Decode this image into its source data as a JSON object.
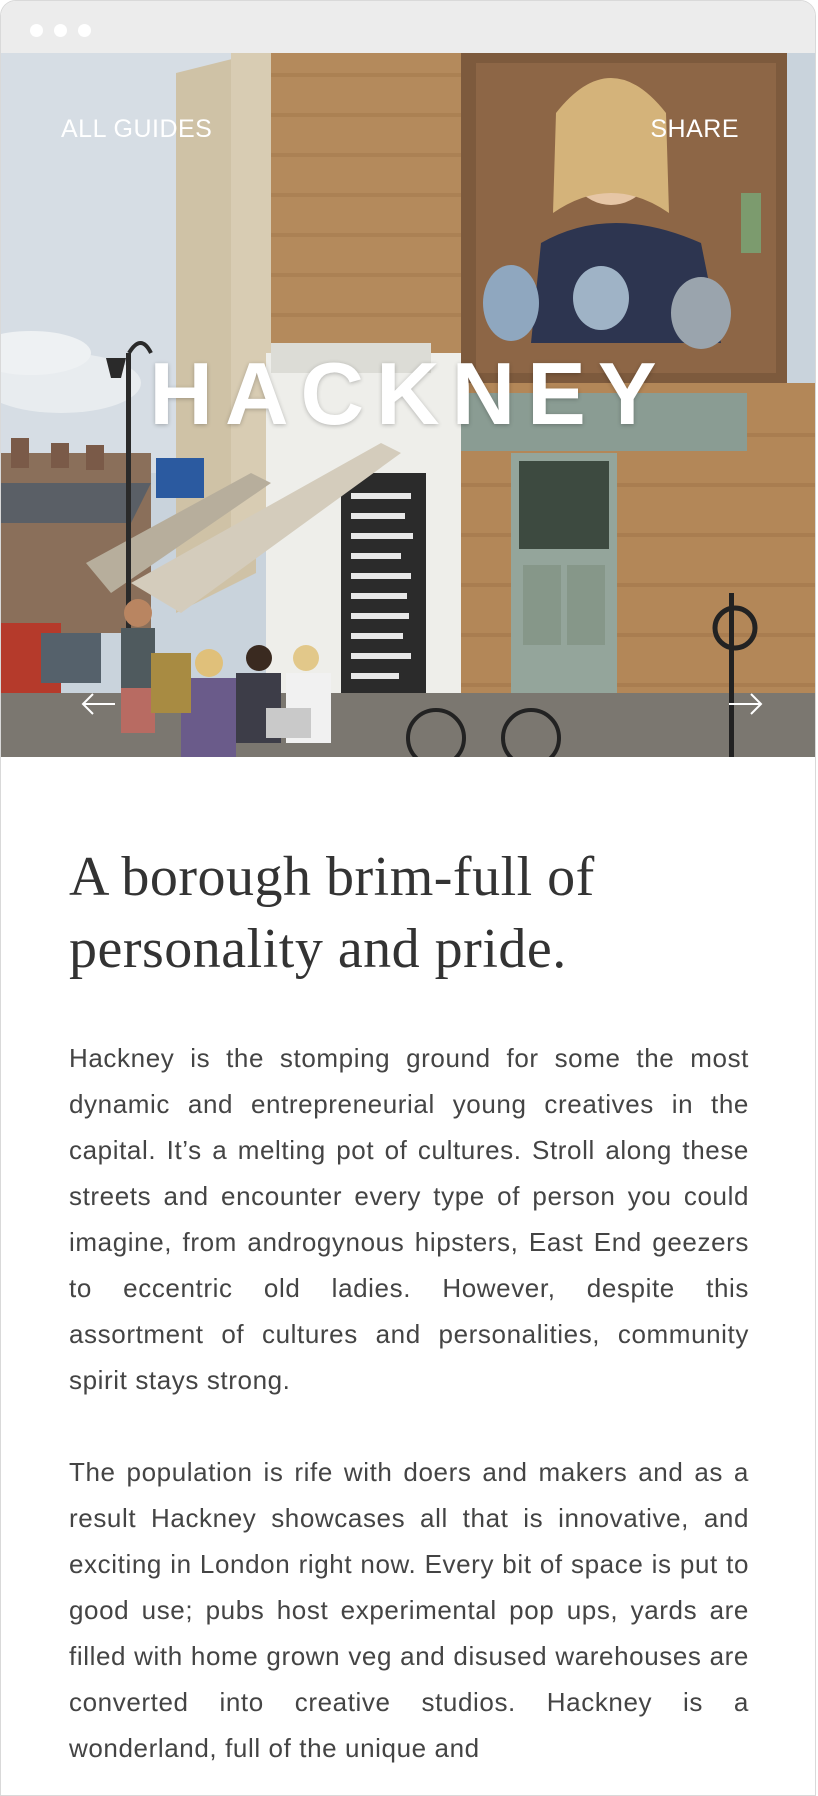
{
  "window": {
    "controls": [
      "close",
      "minimize",
      "maximize"
    ]
  },
  "hero": {
    "title": "HACKNEY",
    "nav_left": "ALL GUIDES",
    "nav_right": "SHARE",
    "prev_icon": "arrow-left-icon",
    "next_icon": "arrow-right-icon"
  },
  "article": {
    "headline": "A borough brim-full of personality and pride.",
    "paragraphs": [
      "Hackney is the stomping ground for some the most dynamic and entrepreneurial young creatives in the capital. It’s a melting pot of cultures. Stroll along these streets and encounter every type of person you could imagine, from androgynous hipsters, East End geezers to eccentric old ladies. However, despite this assortment of cultures and personalities, community spirit stays strong.",
      "The population is rife with doers and makers and as a result Hackney showcases all that is innovative, and exciting in London right now. Every bit of space is put to good use; pubs host experimental pop ups, yards are filled with home grown veg and disused warehouses are converted into creative studios. Hackney is a wonderland, full of the unique and"
    ]
  },
  "colors": {
    "titlebar": "#ececec",
    "text": "#444444",
    "headline": "#333333",
    "hero_text": "#ffffff"
  }
}
